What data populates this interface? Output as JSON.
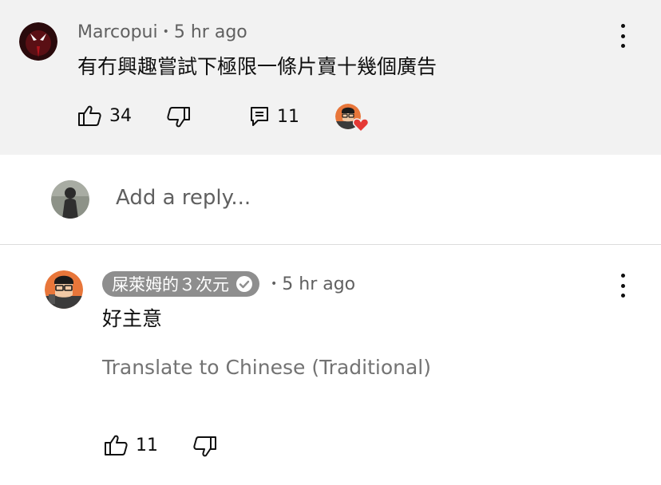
{
  "comment": {
    "author": "Marcopui",
    "time": "5 hr ago",
    "text": "有冇興趣嘗試下極限一條片賣十幾個廣告",
    "likes": "34",
    "replies": "11",
    "icons": {
      "like": "thumb-up-icon",
      "dislike": "thumb-down-icon",
      "reply": "comment-icon",
      "heart": "creator-heart-icon",
      "more": "more-vert-icon"
    }
  },
  "reply_box": {
    "placeholder": "Add a reply..."
  },
  "reply": {
    "author": "屎萊姆的３次元",
    "time": "5 hr ago",
    "text": "好主意",
    "translate": "Translate to Chinese (Traditional)",
    "likes": "11",
    "icons": {
      "verified": "verified-check-icon",
      "like": "thumb-up-icon",
      "dislike": "thumb-down-icon",
      "more": "more-vert-icon"
    }
  },
  "colors": {
    "highlight_bg": "#f2f2f2",
    "heart": "#e53935",
    "chip_bg": "#8e8e8e",
    "secondary_text": "#606060"
  }
}
